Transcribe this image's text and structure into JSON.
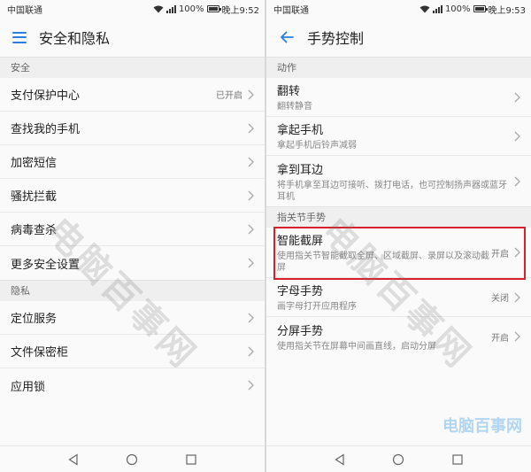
{
  "left": {
    "status": {
      "carrier": "中国联通",
      "battery": "100%",
      "time": "晚上9:52"
    },
    "title": "安全和隐私",
    "section_security": "安全",
    "security_items": [
      {
        "label": "支付保护中心",
        "value": "已开启"
      },
      {
        "label": "查找我的手机"
      },
      {
        "label": "加密短信"
      },
      {
        "label": "骚扰拦截"
      },
      {
        "label": "病毒查杀"
      },
      {
        "label": "更多安全设置"
      }
    ],
    "section_privacy": "隐私",
    "privacy_items": [
      {
        "label": "定位服务"
      },
      {
        "label": "文件保密柜"
      },
      {
        "label": "应用锁"
      }
    ]
  },
  "right": {
    "status": {
      "carrier": "中国联通",
      "battery": "100%",
      "time": "晚上9:53"
    },
    "title": "手势控制",
    "section_actions": "动作",
    "action_items": [
      {
        "label": "翻转",
        "sub": "翻转静音"
      },
      {
        "label": "拿起手机",
        "sub": "拿起手机后铃声减弱"
      },
      {
        "label": "拿到耳边",
        "sub": "将手机拿至耳边可接听、拨打电话，也可控制扬声器或蓝牙耳机"
      }
    ],
    "section_knuckle": "指关节手势",
    "knuckle_items": [
      {
        "label": "智能截屏",
        "sub": "使用指关节智能截取全屏、区域截屏、录屏以及滚动截屏",
        "value": "开启"
      },
      {
        "label": "字母手势",
        "sub": "画字母打开应用程序",
        "value": "关闭"
      },
      {
        "label": "分屏手势",
        "sub": "使用指关节在屏幕中间画直线，启动分屏",
        "value": "开启"
      }
    ]
  },
  "watermark": "电脑百事网",
  "colors": {
    "accent": "#2a7de1",
    "highlight": "#d8202a"
  },
  "icons": [
    "menu-icon",
    "back-arrow-icon",
    "chevron-right-icon",
    "nav-back-icon",
    "nav-home-icon",
    "nav-recents-icon",
    "wifi-icon",
    "signal-icon",
    "battery-icon"
  ]
}
